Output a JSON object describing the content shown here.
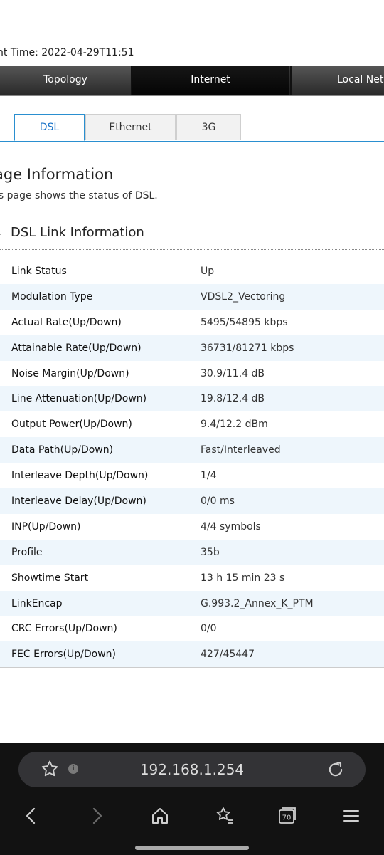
{
  "header": {
    "time_text": "nt Time: 2022-04-29T11:51"
  },
  "topnav": {
    "items": [
      "Topology",
      "Internet",
      "Local Netw"
    ]
  },
  "tabs": [
    "DSL",
    "Ethernet",
    "3G"
  ],
  "page": {
    "title": "age Information",
    "description": "is page shows the status of DSL.",
    "section_title": "DSL Link Information"
  },
  "rows": [
    {
      "label": "Link Status",
      "value": "Up"
    },
    {
      "label": "Modulation Type",
      "value": "VDSL2_Vectoring"
    },
    {
      "label": "Actual Rate(Up/Down)",
      "value": "5495/54895 kbps"
    },
    {
      "label": "Attainable Rate(Up/Down)",
      "value": "36731/81271 kbps"
    },
    {
      "label": "Noise Margin(Up/Down)",
      "value": "30.9/11.4 dB"
    },
    {
      "label": "Line Attenuation(Up/Down)",
      "value": "19.8/12.4 dB"
    },
    {
      "label": "Output Power(Up/Down)",
      "value": "9.4/12.2 dBm"
    },
    {
      "label": "Data Path(Up/Down)",
      "value": "Fast/Interleaved"
    },
    {
      "label": "Interleave Depth(Up/Down)",
      "value": "1/4"
    },
    {
      "label": "Interleave Delay(Up/Down)",
      "value": "0/0 ms"
    },
    {
      "label": "INP(Up/Down)",
      "value": "4/4 symbols"
    },
    {
      "label": "Profile",
      "value": "35b"
    },
    {
      "label": "Showtime Start",
      "value": "13 h 15 min 23 s"
    },
    {
      "label": "LinkEncap",
      "value": "G.993.2_Annex_K_PTM"
    },
    {
      "label": "CRC Errors(Up/Down)",
      "value": "0/0"
    },
    {
      "label": "FEC Errors(Up/Down)",
      "value": "427/45447"
    }
  ],
  "browser": {
    "url": "192.168.1.254",
    "tab_count": "70"
  }
}
